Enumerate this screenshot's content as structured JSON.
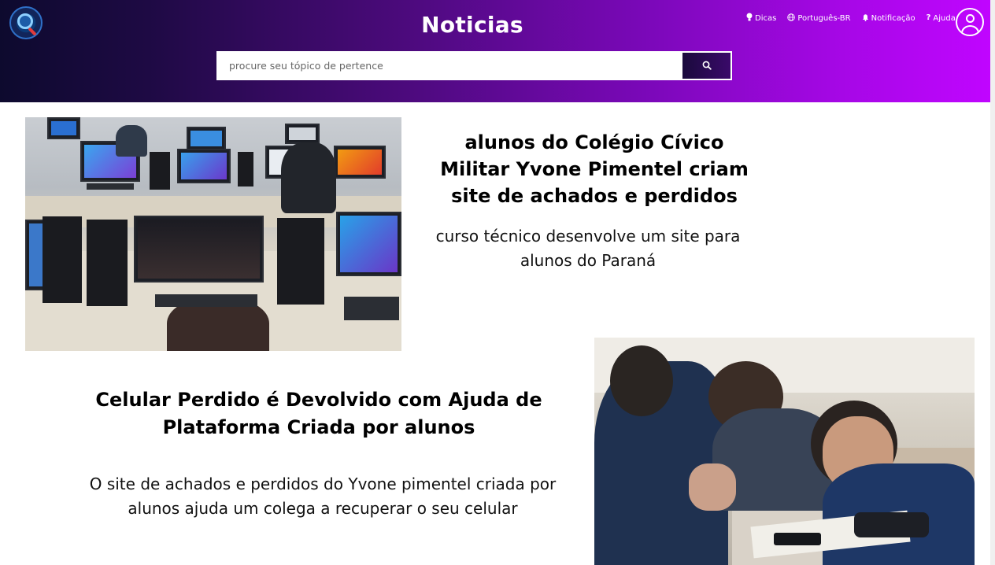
{
  "header": {
    "title": "Noticias",
    "search_placeholder": "procure seu tópico de pertence",
    "nav": {
      "dicas": "Dicas",
      "idioma": "Português-BR",
      "notificacao": "Notificação",
      "ajuda": "Ajuda"
    }
  },
  "articles": [
    {
      "headline": "alunos do Colégio Cívico Militar Yvone Pimentel criam site de achados e perdidos",
      "summary": "curso técnico desenvolve um site para alunos do Paraná"
    },
    {
      "headline": "Celular Perdido é Devolvido com Ajuda de Plataforma Criada por alunos",
      "summary": "O site de achados e perdidos do Yvone pimentel criada por alunos ajuda um colega a recuperar o seu celular"
    }
  ],
  "colors": {
    "header_start": "#0d0a2e",
    "header_end": "#c005ff"
  }
}
